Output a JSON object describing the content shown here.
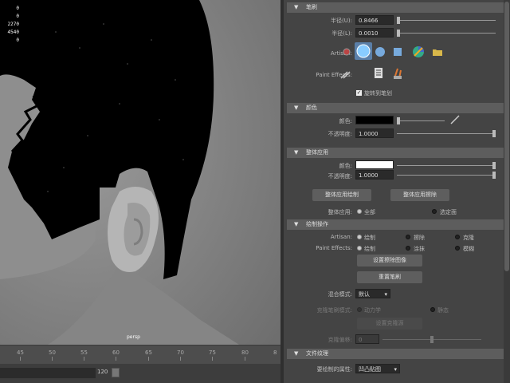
{
  "viewport": {
    "stats": [
      "0",
      "0",
      "2270",
      "4540",
      "0"
    ],
    "camera": "persp"
  },
  "timeline": {
    "ticks": [
      "45",
      "50",
      "55",
      "60",
      "65",
      "70",
      "75",
      "80",
      "8"
    ],
    "range_end": "120"
  },
  "panel": {
    "stroke": {
      "title": "笔刷",
      "radius_u_label": "半径(U):",
      "radius_u_value": "0.8466",
      "radius_l_label": "半径(L):",
      "radius_l_value": "0.0010",
      "artisan_label": "Artisan:",
      "paint_effects_label": "Paint Effects:",
      "rotate_label": "旋转到笔划"
    },
    "color": {
      "title": "颜色",
      "color_label": "颜色:",
      "opacity_label": "不透明度:",
      "opacity_value": "1.0000"
    },
    "flood": {
      "title": "整体应用",
      "color_label": "颜色:",
      "opacity_label": "不透明度:",
      "opacity_value": "1.0000",
      "flood_paint_btn": "整体应用绘制",
      "flood_erase_btn": "整体应用擦除",
      "apply_label": "整体应用:",
      "apply_all": "全部",
      "apply_selected": "选定面"
    },
    "paint_ops": {
      "title": "绘制操作",
      "artisan_label": "Artisan:",
      "artisan_paint": "绘制",
      "artisan_erase": "擦除",
      "artisan_clone": "克隆",
      "pe_label": "Paint Effects:",
      "pe_paint": "绘制",
      "pe_smear": "涂抹",
      "pe_blur": "模糊",
      "set_erase_btn": "设置擦除图像",
      "reset_brush_btn": "重置笔刷",
      "blend_label": "混合模式:",
      "blend_value": "默认",
      "clone_mode_label": "克隆笔刷模式:",
      "clone_dynamic": "动力学",
      "clone_static": "静态",
      "set_clone_btn": "设置克隆源",
      "clone_offset_label": "克隆偏移:",
      "clone_offset_value": "0"
    },
    "file_textures": {
      "title": "文件纹理",
      "attr_label": "要绘制的属性:",
      "attr_value": "凹凸贴图"
    }
  },
  "colors": {
    "paint_color": "#000000",
    "flood_color": "#ffffff",
    "header_bg": "#5d5d5d"
  }
}
